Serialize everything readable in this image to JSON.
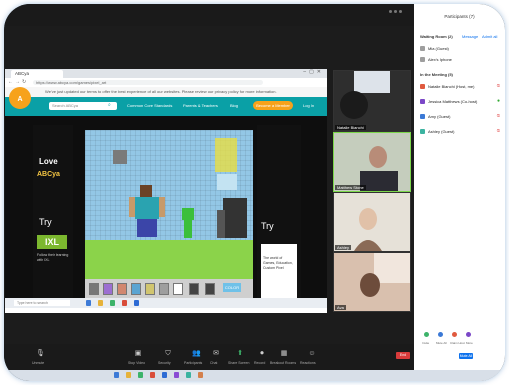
{
  "zoom": {
    "toolbar": [
      {
        "label": "Stop Video",
        "icon": "video-icon"
      },
      {
        "label": "Security",
        "icon": "shield-icon"
      },
      {
        "label": "Participants",
        "icon": "participants-icon"
      },
      {
        "label": "Chat",
        "icon": "chat-icon"
      },
      {
        "label": "Share Screen",
        "icon": "share-screen-icon"
      },
      {
        "label": "Record",
        "icon": "record-icon"
      },
      {
        "label": "Breakout Rooms",
        "icon": "breakout-icon"
      },
      {
        "label": "Reactions",
        "icon": "reactions-icon"
      }
    ],
    "end_label": "End",
    "mute_label": "Unmute"
  },
  "browser": {
    "tab_label": "ABCya",
    "url": "https://www.abcya.com/games/pixel_art",
    "banner": "We've just updated our terms to offer the best experience of all our websites. Please review our privacy policy for more information.",
    "search_placeholder": "Search ABCya",
    "nav": [
      "Common Core Standards",
      "Parents & Teachers",
      "Blog"
    ],
    "signup": "Become a Member",
    "login": "Log In",
    "ad_left": {
      "love": "Love",
      "brand": "ABCya",
      "try": "Try",
      "ixl": "IXL",
      "ixl_text": "Follow their learning with IXL"
    },
    "ad_right": {
      "try": "Try",
      "text": "The world of Games, Education, Custom Pixel"
    },
    "game": {
      "color_btn": "COLOR"
    },
    "taskbar_search": "Type here to search"
  },
  "tiles": [
    {
      "name": "Natalie Bianchi",
      "bg": "#3a3a3a"
    },
    {
      "name": "Matthew Stone",
      "bg": "#b8c4b0"
    },
    {
      "name": "Ashley",
      "bg": "#d9d3c8"
    },
    {
      "name": "Ava",
      "bg": "#d8b8a4"
    }
  ],
  "participants": {
    "title": "Participants (7)",
    "waiting_title": "Waiting Room (2)",
    "message_link": "Message",
    "admit_link": "Admit all",
    "waiting": [
      {
        "name": "Mia (Guest)",
        "color": "#9e9e9e"
      },
      {
        "name": "Alex's Iphone",
        "color": "#9e9e9e"
      }
    ],
    "meeting_title": "In the Meeting (5)",
    "meeting": [
      {
        "name": "Natalie Bianchi (Host, me)",
        "color": "#e05a3f"
      },
      {
        "name": "Jessica Matthews (Co-host)",
        "color": "#7b47c7"
      },
      {
        "name": "Amy (Guest)",
        "color": "#3b79d6"
      },
      {
        "name": "Ashley (Guest)",
        "color": "#3bb3a0"
      }
    ],
    "footer": [
      "Invite",
      "Mute All",
      "Claim Host",
      "More"
    ],
    "footer_btn": "Mute All"
  }
}
